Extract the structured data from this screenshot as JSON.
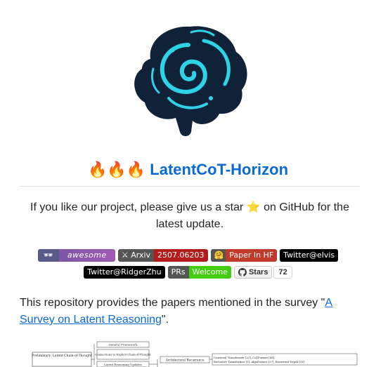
{
  "header": {
    "fire": "🔥🔥🔥",
    "title": "LatentCoT-Horizon"
  },
  "intro": {
    "before": "If you like our project, please give us a star ",
    "star": "⭐",
    "after": " on GitHub for the latest update."
  },
  "badges": {
    "awesome": "awesome",
    "arxiv_label": "Arxiv",
    "arxiv_value": "2507.06203",
    "hf_label": "Paper In HF",
    "twitter_elvis": "Twitter@elvis",
    "twitter_ridger": "Twitter@RidgerZhu",
    "prs_label": "PRs",
    "prs_value": "Welcome",
    "stars_label": "Stars",
    "stars_count": "72"
  },
  "description": {
    "before": "This repository provides the papers mentioned in the survey \"",
    "link": "A Survey on Latent Reasoning",
    "after": "\"."
  },
  "diagram": {
    "left_box": "Preliminary: Latent Chain-of-Thought",
    "mid_items": [
      "General Framework",
      "Connections to Explicit Chain-of-Thought",
      "Latent Reasoning Updates"
    ],
    "arch_box": "Architectural Recurrence",
    "right_line1": "Universal Transformer [22], CoTFormer [46],",
    "right_line2": "Recursive Transformer [2], AlgoFormer [27], Recurrent-Depth [31]"
  },
  "colors": {
    "link": "#0969da",
    "logo_bg": "#0f2238",
    "logo_accent": "#2fd3e8"
  }
}
